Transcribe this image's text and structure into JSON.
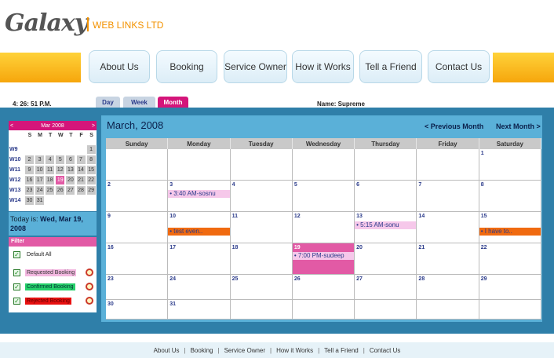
{
  "header": {
    "logo": "Galaxy",
    "company": "WEB LINKS LTD"
  },
  "nav": [
    "About Us",
    "Booking",
    "Service Owner",
    "How it Works",
    "Tell a Friend",
    "Contact Us"
  ],
  "clock": "4: 26: 51 P.M.",
  "view_tabs": [
    "Day",
    "Week",
    "Month"
  ],
  "active_view": "Month",
  "username_label": "Name: Supreme",
  "mini_calendar": {
    "title": "Mar 2008",
    "prev": "<",
    "next": ">",
    "dow": [
      "S",
      "M",
      "T",
      "W",
      "T",
      "F",
      "S"
    ],
    "weeks": [
      {
        "wk": "W9",
        "days": [
          "",
          "",
          "",
          "",
          "",
          "",
          "1"
        ]
      },
      {
        "wk": "W10",
        "days": [
          "2",
          "3",
          "4",
          "5",
          "6",
          "7",
          "8"
        ]
      },
      {
        "wk": "W11",
        "days": [
          "9",
          "10",
          "11",
          "12",
          "13",
          "14",
          "15"
        ]
      },
      {
        "wk": "W12",
        "days": [
          "16",
          "17",
          "18",
          "19",
          "20",
          "21",
          "22"
        ]
      },
      {
        "wk": "W13",
        "days": [
          "23",
          "24",
          "25",
          "26",
          "27",
          "28",
          "29"
        ]
      },
      {
        "wk": "W14",
        "days": [
          "30",
          "31",
          "",
          "",
          "",
          "",
          ""
        ]
      }
    ],
    "today_day": "19"
  },
  "today": {
    "label": "Today is:",
    "value": "Wed, Mar 19, 2008"
  },
  "filter": {
    "title": "Filter",
    "items": [
      {
        "label": "Default All",
        "style": "default"
      },
      {
        "label": "Requested Booking",
        "style": "req"
      },
      {
        "label": "Confirmed Booking",
        "style": "conf"
      },
      {
        "label": "Rejected Booking",
        "style": "rej"
      }
    ]
  },
  "calendar": {
    "title": "March, 2008",
    "prev_label": "<  Previous Month",
    "next_label": "Next Month  >",
    "dow": [
      "Sunday",
      "Monday",
      "Tuesday",
      "Wednesday",
      "Thursday",
      "Friday",
      "Saturday"
    ],
    "weeks": [
      [
        "",
        "",
        "",
        "",
        "",
        "",
        "1"
      ],
      [
        "2",
        "3",
        "4",
        "5",
        "6",
        "7",
        "8"
      ],
      [
        "9",
        "10",
        "11",
        "12",
        "13",
        "14",
        "15"
      ],
      [
        "16",
        "17",
        "18",
        "19",
        "20",
        "21",
        "22"
      ],
      [
        "23",
        "24",
        "25",
        "26",
        "27",
        "28",
        "29"
      ],
      [
        "30",
        "31",
        "",
        "",
        "",
        "",
        ""
      ]
    ],
    "selected_day": "19",
    "events": [
      {
        "day": "3",
        "text": "• 3:40 AM-sosnu",
        "style": "pink"
      },
      {
        "day": "10",
        "text": "• test even..",
        "style": "orange"
      },
      {
        "day": "13",
        "text": "• 5:15 AM-sonu",
        "style": "pink"
      },
      {
        "day": "15",
        "text": "• I have to..",
        "style": "orange"
      },
      {
        "day": "19",
        "text": "• 7:00 PM-sudeep",
        "style": "selbox"
      }
    ]
  },
  "footer": [
    "About Us",
    "Booking",
    "Service Owner",
    "How it Works",
    "Tell a Friend",
    "Contact Us"
  ],
  "colors": {
    "accent": "#d4157a",
    "panel": "#2f7fa9",
    "orange": "#f39200"
  }
}
